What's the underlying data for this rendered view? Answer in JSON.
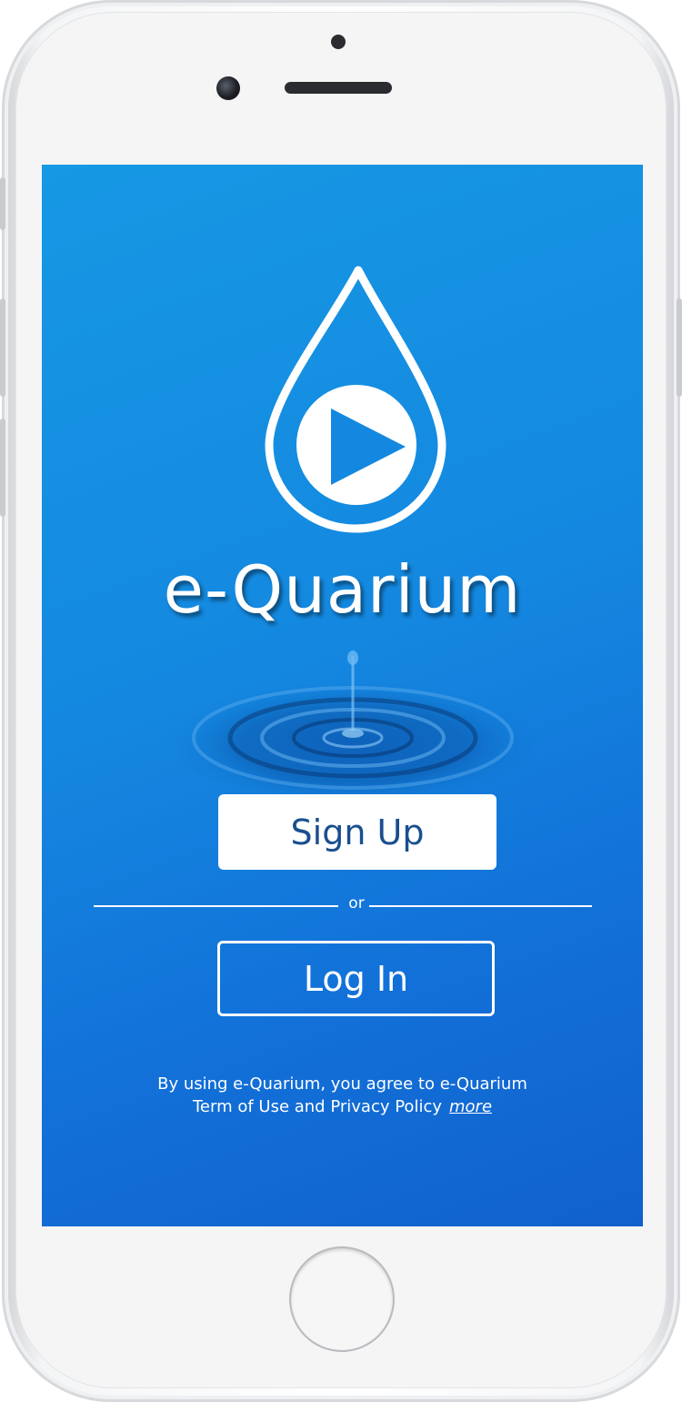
{
  "app": {
    "brand_name": "e-Quarium"
  },
  "actions": {
    "signup_label": "Sign Up",
    "divider_text": "or",
    "login_label": "Log In"
  },
  "legal": {
    "line1": "By using e-Quarium, you agree to e-Quarium",
    "line2": "Term of Use and Privacy Policy",
    "more_link": "more"
  },
  "icons": {
    "logo": "water-drop-play-icon",
    "ripple": "water-ripple-illustration"
  },
  "colors": {
    "screen_top": "#1698e4",
    "screen_bottom": "#1161cc",
    "signup_text": "#1a4f8f",
    "white": "#ffffff"
  }
}
